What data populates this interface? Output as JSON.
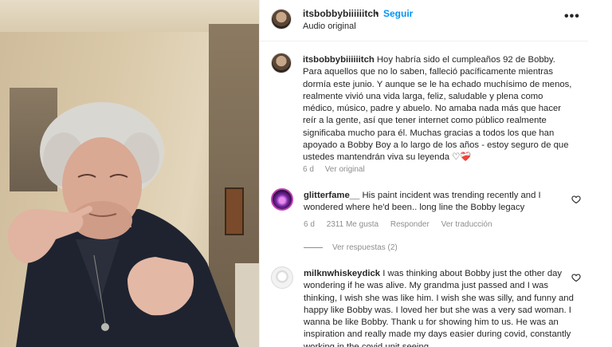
{
  "post": {
    "author": "itsbobbybiiiiiitch",
    "separator": "•",
    "follow_label": "Seguir",
    "audio": "Audio original",
    "more_icon": "more-horizontal-icon"
  },
  "caption": {
    "author": "itsbobbybiiiiiitch",
    "text": "Hoy habría sido el cumpleaños 92 de Bobby. Para aquellos que no lo saben, falleció pacíficamente mientras dormía este junio. Y aunque se le ha echado muchísimo de menos, realmente vivió una vida larga, feliz, saludable y plena como médico, músico, padre y abuelo. No amaba nada más que hacer reír a la gente, así que tener internet como público realmente significaba mucho para él. Muchas gracias a todos los que han apoyado a Bobby Boy a lo largo de los años - estoy seguro de que ustedes mantendrán viva su leyenda ♡❤️‍🩹",
    "age": "6 d",
    "see_original": "Ver original"
  },
  "comments": [
    {
      "author": "glitterfame__",
      "text": "His paint incident was trending recently and I wondered where he'd been.. long line the Bobby legacy",
      "age": "6 d",
      "likes": "2311 Me gusta",
      "reply": "Responder",
      "translate": "Ver traducción",
      "view_replies": "Ver respuestas (2)"
    },
    {
      "author": "milknwhiskeydick",
      "text": "I was thinking about Bobby just the other day wondering if he was alive. My grandma just passed and I was thinking, I wish she was like him. I wish she was silly, and funny and happy like Bobby was. I loved her but she was a very sad woman. I wanna be like Bobby. Thank u for showing him to us. He was an inspiration and really made my days easier during covid, constantly working in the covid unit seeing"
    }
  ]
}
